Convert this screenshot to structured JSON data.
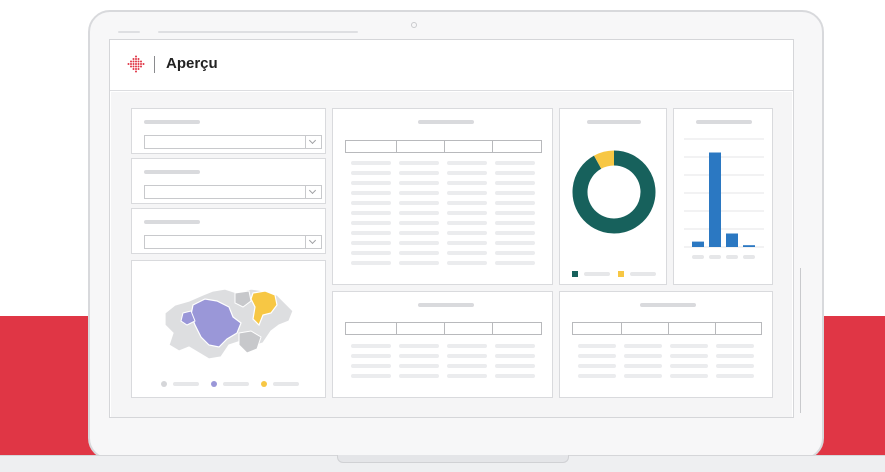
{
  "app": {
    "title": "Aperçu",
    "logo_icon": "diamond-dots-logo-icon",
    "logo_color": "#e03645"
  },
  "colors": {
    "brand_red": "#e03645",
    "teal": "#17615c",
    "yellow": "#f7c744",
    "blue": "#2b78c2",
    "purple": "#9a97d8",
    "map_gray": "#dddee0"
  },
  "filters": [
    {
      "id": "filter-1",
      "placeholder": ""
    },
    {
      "id": "filter-2",
      "placeholder": ""
    },
    {
      "id": "filter-3",
      "placeholder": ""
    }
  ],
  "chart_data": [
    {
      "type": "pie",
      "values": [
        0.92,
        0.08
      ],
      "colors": [
        "#17615c",
        "#f7c744"
      ]
    },
    {
      "type": "bar",
      "values": [
        6,
        105,
        15,
        2
      ],
      "ylim": [
        0,
        120
      ],
      "colors": [
        "#2b78c2",
        "#2b78c2",
        "#2b78c2",
        "#2b78c2"
      ]
    }
  ],
  "map": {
    "legend": [
      {
        "color": "#d5d6d9"
      },
      {
        "color": "#9a97d8"
      },
      {
        "color": "#f7c744"
      }
    ]
  }
}
